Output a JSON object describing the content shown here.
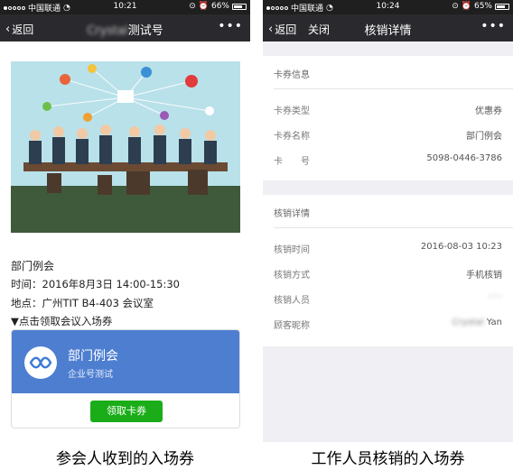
{
  "left": {
    "status": {
      "carrier": "中国联通",
      "time": "10:21",
      "battery": "66%",
      "battery_level": 0.66
    },
    "nav": {
      "back": "返回",
      "title_blur": "Crystal",
      "title": "测试号",
      "more": "•••"
    },
    "meeting": {
      "title": "部门例会",
      "time": "时间：2016年8月3日 14:00-15:30",
      "place": "地点：广州TIT B4-403 会议室",
      "hint": "▼点击领取会议入场券"
    },
    "card": {
      "name": "部门例会",
      "org": "企业号测试",
      "button": "领取卡券"
    }
  },
  "right": {
    "status": {
      "carrier": "中国联通",
      "time": "10:24",
      "battery": "65%",
      "battery_level": 0.65
    },
    "nav": {
      "back": "返回",
      "close": "关闭",
      "title": "核销详情",
      "more": "•••"
    },
    "card_info": {
      "heading": "卡券信息",
      "rows": [
        {
          "label": "卡券类型",
          "value": "优惠券"
        },
        {
          "label": "卡券名称",
          "value": "部门例会"
        },
        {
          "label": "卡　　号",
          "value": "5098-0446-3786"
        }
      ]
    },
    "verify": {
      "heading": "核销详情",
      "rows": [
        {
          "label": "核销时间",
          "value": "2016-08-03 10:23"
        },
        {
          "label": "核销方式",
          "value": "手机核销"
        },
        {
          "label": "核销人员",
          "value": "·····"
        },
        {
          "label": "顾客昵称",
          "value": "Yan",
          "blur_prefix": "Crystal"
        }
      ]
    }
  },
  "captions": {
    "left": "参会人收到的入场券",
    "right": "工作人员核销的入场券"
  }
}
